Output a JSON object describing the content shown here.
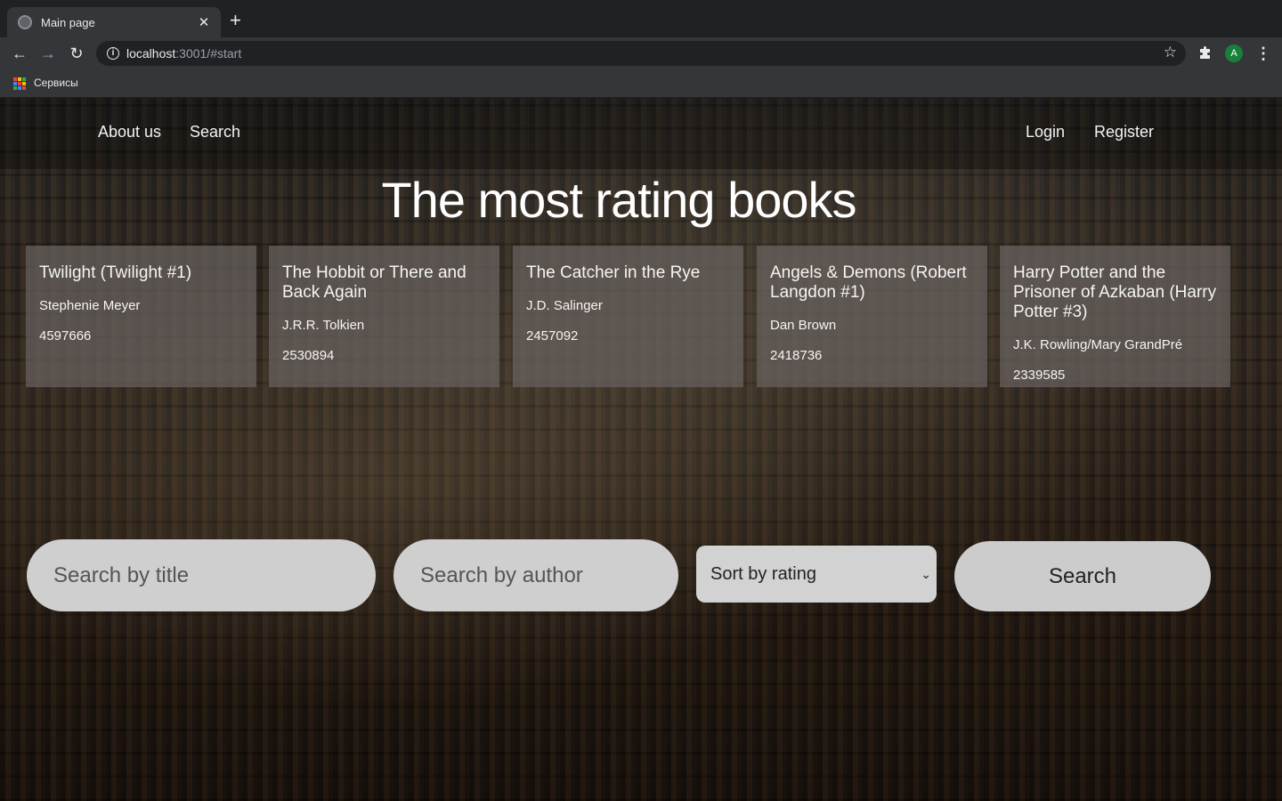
{
  "browser": {
    "tab_title": "Main page",
    "url_host": "localhost",
    "url_rest": ":3001/#start",
    "avatar_letter": "A",
    "bookmark_label": "Сервисы"
  },
  "nav": {
    "about": "About us",
    "search": "Search",
    "login": "Login",
    "register": "Register"
  },
  "headline": "The most rating books",
  "books": [
    {
      "title": "Twilight (Twilight #1)",
      "author": "Stephenie Meyer",
      "count": "4597666"
    },
    {
      "title": "The Hobbit or There and Back Again",
      "author": "J.R.R. Tolkien",
      "count": "2530894"
    },
    {
      "title": "The Catcher in the Rye",
      "author": "J.D. Salinger",
      "count": "2457092"
    },
    {
      "title": "Angels & Demons (Robert Langdon #1)",
      "author": "Dan Brown",
      "count": "2418736"
    },
    {
      "title": "Harry Potter and the Prisoner of Azkaban (Harry Potter #3)",
      "author": "J.K. Rowling/Mary GrandPré",
      "count": "2339585"
    }
  ],
  "search_form": {
    "title_placeholder": "Search by title",
    "author_placeholder": "Search by author",
    "sort_selected": "Sort by rating",
    "button_label": "Search"
  },
  "colors": {
    "chrome_dark": "#202124",
    "chrome_toolbar": "#35363a",
    "avatar_bg": "#188038"
  }
}
